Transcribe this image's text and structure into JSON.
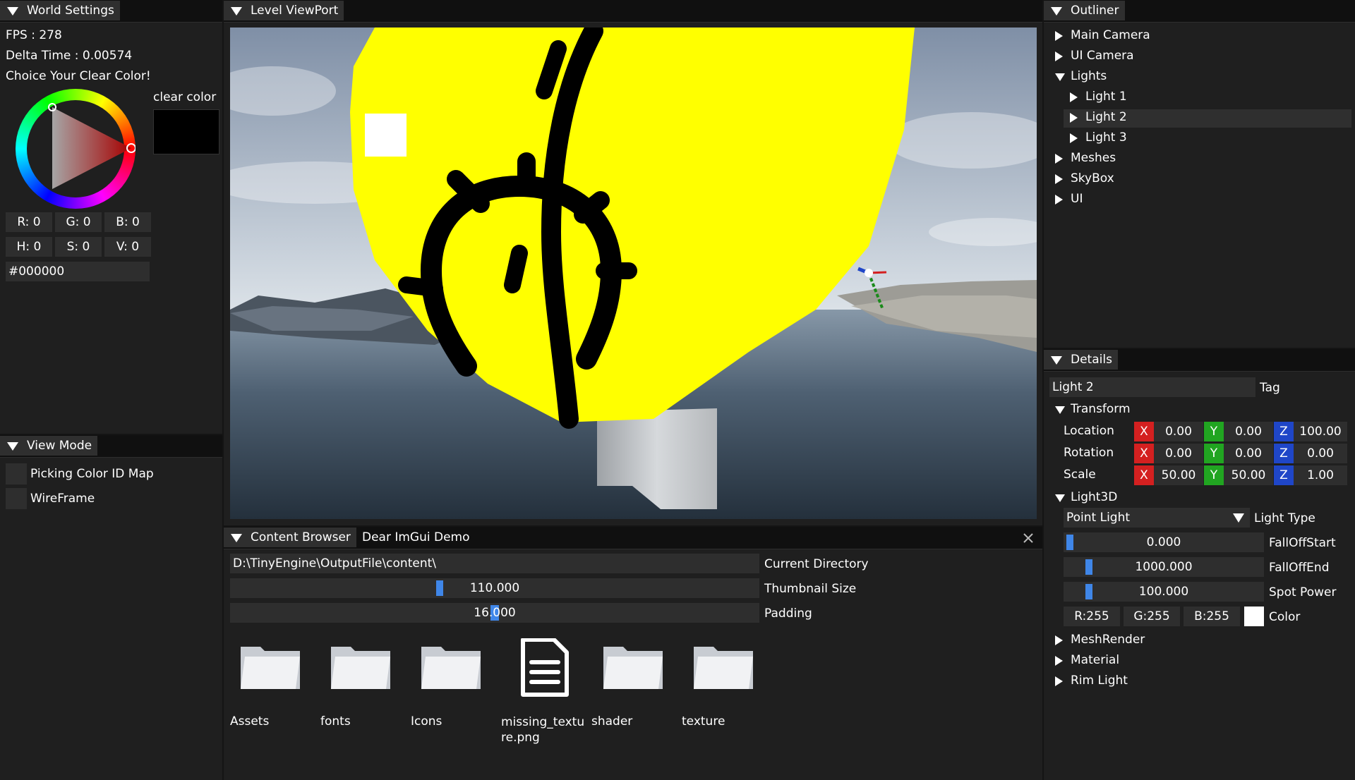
{
  "world_settings": {
    "tab": "World Settings",
    "fps": "FPS : 278",
    "delta": "Delta Time : 0.00574",
    "choice": "Choice Your Clear Color!",
    "clear_color_label": "clear color",
    "clear_color": "#000000",
    "rgb": [
      "R:  0",
      "G:  0",
      "B:  0"
    ],
    "hsv": [
      "H:  0",
      "S:  0",
      "V:  0"
    ],
    "hex": "#000000"
  },
  "view_mode": {
    "tab": "View Mode",
    "options": [
      "Picking Color ID Map",
      "WireFrame"
    ]
  },
  "viewport": {
    "tab": "Level ViewPort"
  },
  "outliner": {
    "tab": "Outliner",
    "items": [
      "Main Camera",
      "UI Camera",
      "Lights",
      "Light 1",
      "Light 2",
      "Light 3",
      "Meshes",
      "SkyBox",
      "UI"
    ]
  },
  "details": {
    "tab": "Details",
    "name": "Light 2",
    "tag_label": "Tag",
    "transform_label": "Transform",
    "rows": [
      {
        "label": "Location",
        "x": "0.00",
        "y": "0.00",
        "z": "100.00"
      },
      {
        "label": "Rotation",
        "x": "0.00",
        "y": "0.00",
        "z": "0.00"
      },
      {
        "label": "Scale",
        "x": "50.00",
        "y": "50.00",
        "z": "1.00"
      }
    ],
    "axis": {
      "x": "X",
      "y": "Y",
      "z": "Z"
    },
    "light3d_label": "Light3D",
    "light_type": "Point Light",
    "light_type_label": "Light Type",
    "falloff_start": "0.000",
    "falloff_start_label": "FallOffStart",
    "falloff_end": "1000.000",
    "falloff_end_label": "FallOffEnd",
    "spot_power": "100.000",
    "spot_power_label": "Spot Power",
    "color": {
      "r": "R:255",
      "g": "G:255",
      "b": "B:255",
      "label": "Color"
    },
    "sections": [
      "MeshRender",
      "Material",
      "Rim Light"
    ]
  },
  "content_browser": {
    "tab": "Content Browser",
    "tab2": "Dear ImGui Demo",
    "directory": "D:\\TinyEngine\\OutputFile\\content\\",
    "directory_label": "Current Directory",
    "thumb_size": "110.000",
    "thumb_label": "Thumbnail Size",
    "padding": "16.000",
    "padding_label": "Padding",
    "files": [
      "Assets",
      "fonts",
      "Icons",
      "missing_texture.png",
      "shader",
      "texture"
    ]
  },
  "colors": {
    "accent": "#3f86e8",
    "axis_x": "#d42020",
    "axis_y": "#21a521",
    "axis_z": "#1f46c8",
    "yellow": "#ffff00"
  }
}
